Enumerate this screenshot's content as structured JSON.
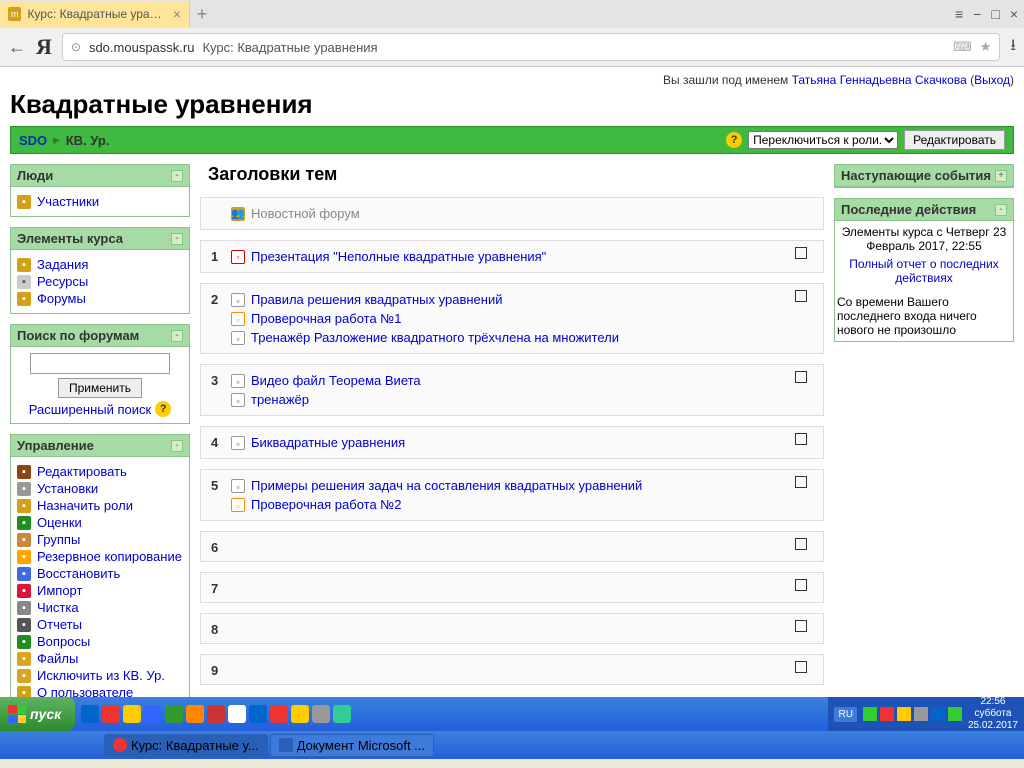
{
  "browser": {
    "tab_title": "Курс: Квадратные уравн...",
    "domain": "sdo.mouspassk.ru",
    "page_title_in_addr": "Курс: Квадратные уравнения"
  },
  "login": {
    "prefix": "Вы зашли под именем ",
    "username": "Татьяна Геннадьевна Скачкова",
    "logout": "Выход"
  },
  "page_title": "Квадратные уравнения",
  "navbar": {
    "root": "SDO",
    "sep": "▸",
    "current": "КВ. Ур.",
    "role_switch": "Переключиться к роли...",
    "edit_btn": "Редактировать"
  },
  "blocks": {
    "people": {
      "title": "Люди",
      "items": [
        {
          "icon": "users",
          "label": "Участники"
        }
      ]
    },
    "elements": {
      "title": "Элементы курса",
      "items": [
        {
          "icon": "task",
          "label": "Задания"
        },
        {
          "icon": "res",
          "label": "Ресурсы"
        },
        {
          "icon": "forum",
          "label": "Форумы"
        }
      ]
    },
    "search": {
      "title": "Поиск по форумам",
      "btn": "Применить",
      "adv": "Расширенный поиск"
    },
    "admin": {
      "title": "Управление",
      "items": [
        {
          "icon": "edit",
          "label": "Редактировать"
        },
        {
          "icon": "settings",
          "label": "Установки"
        },
        {
          "icon": "roles",
          "label": "Назначить роли"
        },
        {
          "icon": "grades",
          "label": "Оценки"
        },
        {
          "icon": "groups",
          "label": "Группы"
        },
        {
          "icon": "backup",
          "label": "Резервное копирование"
        },
        {
          "icon": "restore",
          "label": "Восстановить"
        },
        {
          "icon": "import",
          "label": "Импорт"
        },
        {
          "icon": "clean",
          "label": "Чистка"
        },
        {
          "icon": "reports",
          "label": "Отчеты"
        },
        {
          "icon": "questions",
          "label": "Вопросы"
        },
        {
          "icon": "files",
          "label": "Файлы"
        },
        {
          "icon": "exclude",
          "label": "Исключить из КВ. Ур."
        },
        {
          "icon": "user",
          "label": "О пользователе"
        }
      ]
    },
    "upcoming": {
      "title": "Наступающие события"
    },
    "recent": {
      "title": "Последние действия",
      "since": "Элементы курса с Четверг 23 Февраль 2017, 22:55",
      "report": "Полный отчет о последних действиях",
      "nothing": "Со времени Вашего последнего входа ничего нового не произошло"
    }
  },
  "topics": {
    "heading": "Заголовки тем",
    "news_forum": "Новостной форум",
    "sections": [
      {
        "num": "1",
        "items": [
          {
            "icon": "ppt",
            "label": "Презентация \"Неполные квадратные уравнения\""
          }
        ],
        "check": true
      },
      {
        "num": "2",
        "items": [
          {
            "icon": "page",
            "label": "Правила решения квадратных уравнений"
          },
          {
            "icon": "hot",
            "label": "Проверочная работа №1"
          },
          {
            "icon": "page",
            "label": "Тренажёр Разложение квадратного трёхчлена на множители"
          }
        ],
        "check": true
      },
      {
        "num": "3",
        "items": [
          {
            "icon": "page",
            "label": "Видео файл Теорема Виета"
          },
          {
            "icon": "page",
            "label": "тренажёр"
          }
        ],
        "check": true
      },
      {
        "num": "4",
        "items": [
          {
            "icon": "page",
            "label": "Биквадратные уравнения"
          }
        ],
        "check": true
      },
      {
        "num": "5",
        "items": [
          {
            "icon": "page",
            "label": "Примеры решения задач на составления квадратных уравнений"
          },
          {
            "icon": "hot",
            "label": "Проверочная работа №2"
          }
        ],
        "check": true
      },
      {
        "num": "6",
        "items": [],
        "check": true
      },
      {
        "num": "7",
        "items": [],
        "check": true
      },
      {
        "num": "8",
        "items": [],
        "check": true
      },
      {
        "num": "9",
        "items": [],
        "check": true
      }
    ]
  },
  "taskbar": {
    "start": "пуск",
    "item1": "Курс: Квадратные у...",
    "item2": "Документ Microsoft ...",
    "lang": "RU",
    "time": "22:56",
    "day": "суббота",
    "date": "25.02.2017"
  }
}
